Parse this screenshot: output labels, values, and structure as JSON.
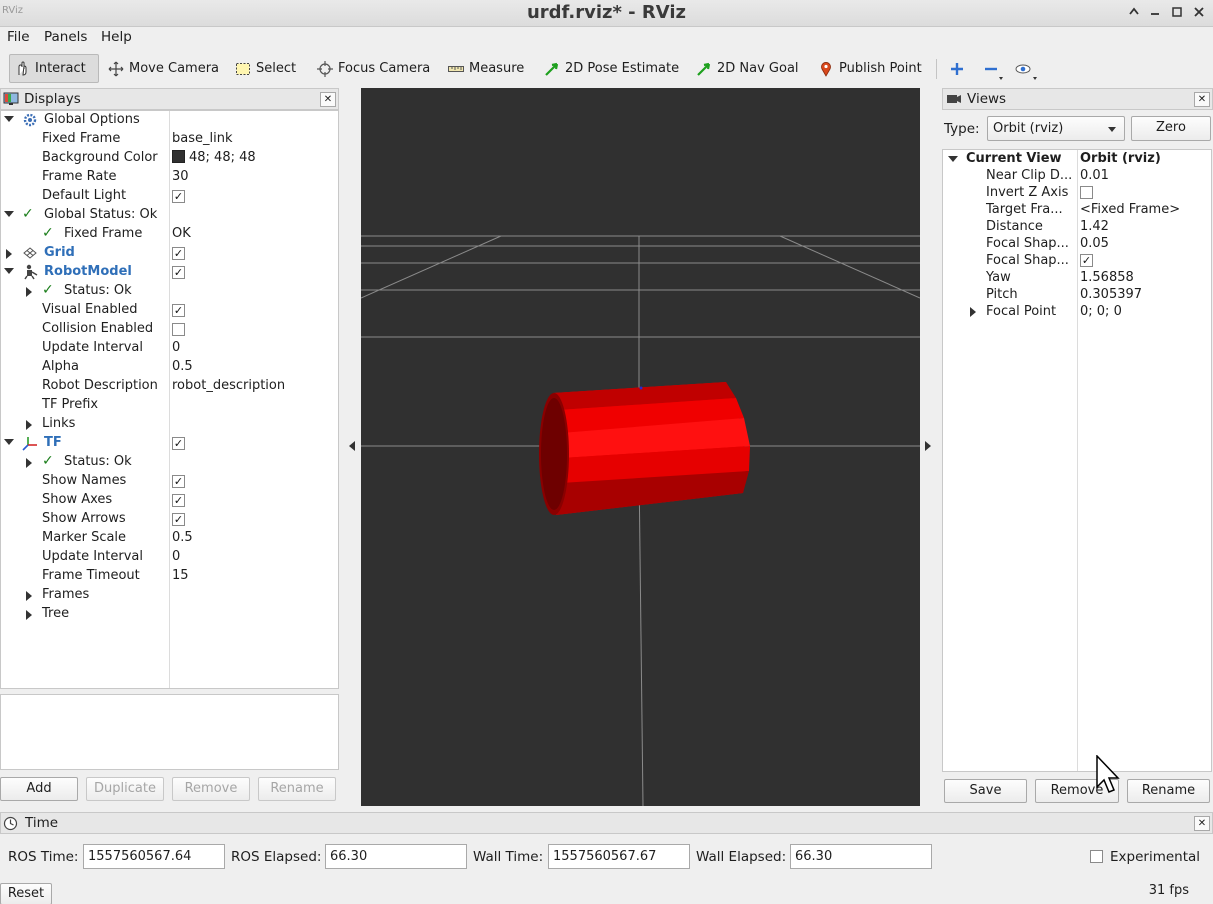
{
  "window": {
    "icon_text": "RViz",
    "title": "urdf.rviz* - RViz"
  },
  "menu": [
    "File",
    "Panels",
    "Help"
  ],
  "toolbar": {
    "tools": [
      "Interact",
      "Move Camera",
      "Select",
      "Focus Camera",
      "Measure",
      "2D Pose Estimate",
      "2D Nav Goal",
      "Publish Point"
    ],
    "active_tool": "Interact"
  },
  "displays": {
    "title": "Displays",
    "rows": [
      {
        "name": "Global Options"
      },
      {
        "name": "Fixed Frame",
        "value": "base_link"
      },
      {
        "name": "Background Color",
        "value": "48; 48; 48"
      },
      {
        "name": "Frame Rate",
        "value": "30"
      },
      {
        "name": "Default Light",
        "checked": true
      },
      {
        "name": "Global Status: Ok"
      },
      {
        "name": "Fixed Frame",
        "value": "OK"
      },
      {
        "name": "Grid",
        "checked": true
      },
      {
        "name": "RobotModel",
        "checked": true
      },
      {
        "name": "Status: Ok"
      },
      {
        "name": "Visual Enabled",
        "checked": true
      },
      {
        "name": "Collision Enabled",
        "checked": false
      },
      {
        "name": "Update Interval",
        "value": "0"
      },
      {
        "name": "Alpha",
        "value": "0.5"
      },
      {
        "name": "Robot Description",
        "value": "robot_description"
      },
      {
        "name": "TF Prefix",
        "value": ""
      },
      {
        "name": "Links"
      },
      {
        "name": "TF",
        "checked": true
      },
      {
        "name": "Status: Ok"
      },
      {
        "name": "Show Names",
        "checked": true
      },
      {
        "name": "Show Axes",
        "checked": true
      },
      {
        "name": "Show Arrows",
        "checked": true
      },
      {
        "name": "Marker Scale",
        "value": "0.5"
      },
      {
        "name": "Update Interval",
        "value": "0"
      },
      {
        "name": "Frame Timeout",
        "value": "15"
      },
      {
        "name": "Frames"
      },
      {
        "name": "Tree"
      }
    ],
    "buttons": [
      "Add",
      "Duplicate",
      "Remove",
      "Rename"
    ],
    "check_mark": "✓"
  },
  "views": {
    "title": "Views",
    "type_label": "Type:",
    "type_value": "Orbit (rviz)",
    "zero_label": "Zero",
    "rows": [
      {
        "name": "Current View",
        "value": "Orbit (rviz)"
      },
      {
        "name": "Near Clip D...",
        "value": "0.01"
      },
      {
        "name": "Invert Z Axis",
        "checked": false
      },
      {
        "name": "Target Fra...",
        "value": "<Fixed Frame>"
      },
      {
        "name": "Distance",
        "value": "1.42"
      },
      {
        "name": "Focal Shap...",
        "value": "0.05"
      },
      {
        "name": "Focal Shap...",
        "checked": true
      },
      {
        "name": "Yaw",
        "value": "1.56858"
      },
      {
        "name": "Pitch",
        "value": "0.305397"
      },
      {
        "name": "Focal Point",
        "value": "0; 0; 0"
      }
    ],
    "buttons": [
      "Save",
      "Remove",
      "Rename"
    ]
  },
  "time": {
    "title": "Time",
    "ros_time_label": "ROS Time:",
    "ros_time": "1557560567.64",
    "ros_elapsed_label": "ROS Elapsed:",
    "ros_elapsed": "66.30",
    "wall_time_label": "Wall Time:",
    "wall_time": "1557560567.67",
    "wall_elapsed_label": "Wall Elapsed:",
    "wall_elapsed": "66.30",
    "experimental_label": "Experimental",
    "experimental_checked": false,
    "reset_label": "Reset",
    "fps": "31 fps"
  },
  "colors": {
    "viewport_background": "#303030",
    "robot_model": "#ff0000",
    "status_ok": "#1b7e1b",
    "display_name_accent": "#2f6fb8"
  }
}
